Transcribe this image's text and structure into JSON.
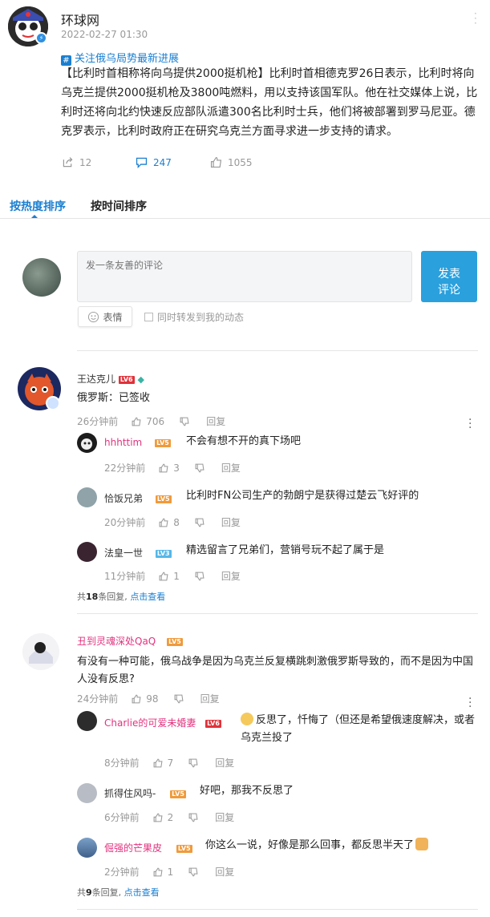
{
  "post": {
    "author": "环球网",
    "time": "2022-02-27 01:30",
    "topic": "关注俄乌局势最新进展",
    "body": "【比利时首相称将向乌提供2000挺机枪】比利时首相德克罗26日表示，比利时将向乌克兰提供2000挺机枪及3800吨燃料，用以支持该国军队。他在社交媒体上说，比利时还将向北约快速反应部队派遣300名比利时士兵，他们将被部署到罗马尼亚。德克罗表示，比利时政府正在研究乌克兰方面寻求进一步支持的请求。",
    "shares": "12",
    "comments": "247",
    "likes": "1055"
  },
  "tabs": [
    "按热度排序",
    "按时间排序"
  ],
  "composer": {
    "placeholder": "发一条友善的评论",
    "submit": "发表\n评论",
    "submit_l1": "发表",
    "submit_l2": "评论",
    "emoji": "表情",
    "repost": "同时转发到我的动态"
  },
  "labels": {
    "reply": "回复",
    "view": "点击查看"
  },
  "threads": [
    {
      "name": "王达克儿",
      "level": "LV6",
      "text": "俄罗斯：已签收",
      "time": "26分钟前",
      "likes": "706",
      "replies": [
        {
          "name": "hhhttim",
          "level": "LV5",
          "text": "不会有想不开的真下场吧",
          "time": "22分钟前",
          "likes": "3"
        },
        {
          "name": "恰饭兄弟",
          "level": "LV5",
          "text": "比利时FN公司生产的勃朗宁是获得过楚云飞好评的",
          "time": "20分钟前",
          "likes": "8"
        },
        {
          "name": "法皇一世",
          "level": "LV3",
          "text": "精选留言了兄弟们，营销号玩不起了属于是",
          "time": "11分钟前",
          "likes": "1"
        }
      ],
      "summary_pre": "共",
      "summary_count": "18",
      "summary_post": "条回复,"
    },
    {
      "name": "丑到灵魂深处QaQ",
      "level": "LV5",
      "text": "有没有一种可能，俄乌战争是因为乌克兰反复横跳刺激俄罗斯导致的，而不是因为中国人没有反思?",
      "time": "24分钟前",
      "likes": "98",
      "replies": [
        {
          "name": "Charlie的可爱未婚妻",
          "level": "LV6",
          "text": "反思了，忏悔了（但还是希望俄速度解决，或者乌克兰投了",
          "time": "8分钟前",
          "likes": "7"
        },
        {
          "name": "抓得住风吗-",
          "level": "LV5",
          "text": "好吧，那我不反思了",
          "time": "6分钟前",
          "likes": "2"
        },
        {
          "name": "倔强的芒果皮",
          "level": "LV5",
          "text": "你这么一说，好像是那么回事，都反思半天了",
          "time": "2分钟前",
          "likes": "1"
        }
      ],
      "summary_pre": "共",
      "summary_count": "9",
      "summary_post": "条回复,"
    }
  ],
  "colors": {
    "accent": "#1a7fd1",
    "button": "#2aa0dd",
    "pink_name": "#e2327e",
    "lv6": "#e0323a",
    "lv5": "#f09a3b",
    "lv3": "#55b7e8"
  }
}
